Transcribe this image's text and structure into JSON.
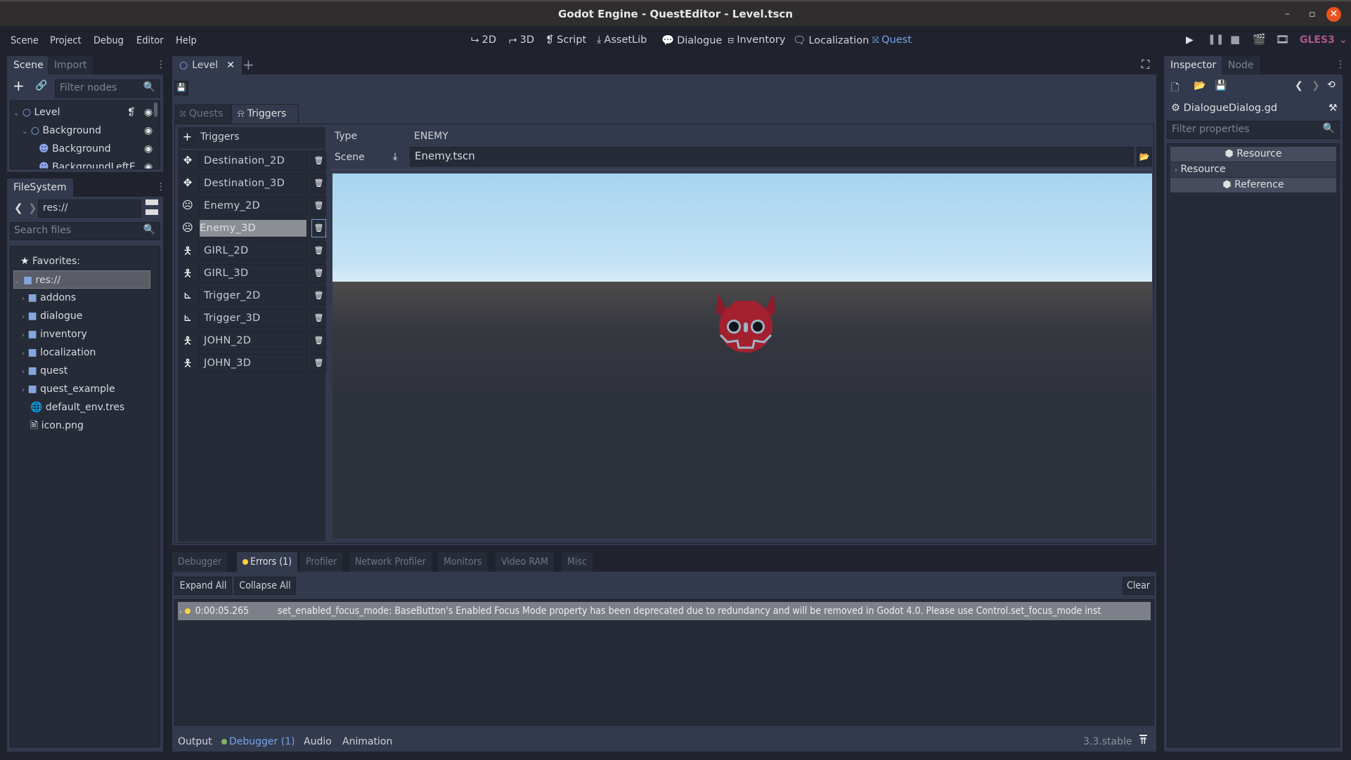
{
  "window": {
    "title": "Godot Engine - QuestEditor - Level.tscn",
    "controls": {
      "minimize": "–",
      "maximize": "▫",
      "close": "✕"
    }
  },
  "menu": [
    "Scene",
    "Project",
    "Debug",
    "Editor",
    "Help"
  ],
  "workspaces": [
    {
      "label": "2D",
      "icon": "2d-axis-icon"
    },
    {
      "label": "3D",
      "icon": "3d-axis-icon"
    },
    {
      "label": "Script",
      "icon": "script-icon"
    },
    {
      "label": "AssetLib",
      "icon": "download-icon"
    },
    {
      "label": "Dialogue",
      "icon": "dialogue-icon"
    },
    {
      "label": "Inventory",
      "icon": "inventory-icon"
    },
    {
      "label": "Localization",
      "icon": "localization-icon"
    },
    {
      "label": "Quest",
      "icon": "quest-icon",
      "active": true
    }
  ],
  "run_controls": {
    "renderer": "GLES3",
    "renderer_color": "#b0588a"
  },
  "scene_dock": {
    "tabs": [
      "Scene",
      "Import"
    ],
    "filter_placeholder": "Filter nodes",
    "nodes": [
      {
        "name": "Level",
        "depth": 0,
        "type": "node2d",
        "has_script": true
      },
      {
        "name": "Background",
        "depth": 1,
        "type": "node2d"
      },
      {
        "name": "Background",
        "depth": 2,
        "type": "sprite"
      },
      {
        "name": "BackgroundLeftE",
        "depth": 2,
        "type": "sprite"
      }
    ]
  },
  "filesystem": {
    "tab": "FileSystem",
    "path": "res://",
    "search_placeholder": "Search files",
    "favorites_label": "Favorites:",
    "root": "res://",
    "folders": [
      "addons",
      "dialogue",
      "inventory",
      "localization",
      "quest",
      "quest_example"
    ],
    "files": [
      {
        "name": "default_env.tres",
        "icon": "environment-icon"
      },
      {
        "name": "icon.png",
        "icon": "image-icon"
      }
    ]
  },
  "editor_tabs": {
    "active": "Level"
  },
  "quest_editor": {
    "tabs": [
      "Quests",
      "Triggers"
    ],
    "active_tab": "Triggers",
    "triggers_header": "Triggers",
    "triggers": [
      {
        "name": "Destination_2D",
        "icon": "move-icon"
      },
      {
        "name": "Destination_3D",
        "icon": "move-icon"
      },
      {
        "name": "Enemy_2D",
        "icon": "enemy-icon"
      },
      {
        "name": "Enemy_3D",
        "icon": "enemy-icon",
        "selected": true
      },
      {
        "name": "GIRL_2D",
        "icon": "person-icon"
      },
      {
        "name": "GIRL_3D",
        "icon": "person-icon"
      },
      {
        "name": "Trigger_2D",
        "icon": "lever-icon"
      },
      {
        "name": "Trigger_3D",
        "icon": "lever-icon"
      },
      {
        "name": "JOHN_2D",
        "icon": "person-icon"
      },
      {
        "name": "JOHN_3D",
        "icon": "person-icon"
      }
    ],
    "type_label": "Type",
    "type_value": "ENEMY",
    "scene_label": "Scene",
    "scene_value": "Enemy.tscn"
  },
  "debugger": {
    "tabs": [
      "Debugger",
      "Errors (1)",
      "Profiler",
      "Network Profiler",
      "Monitors",
      "Video RAM",
      "Misc"
    ],
    "active_tab": "Errors (1)",
    "expand_all": "Expand All",
    "collapse_all": "Collapse All",
    "clear": "Clear",
    "errors": [
      {
        "time": "0:00:05.265",
        "message": "set_enabled_focus_mode: BaseButton's Enabled Focus Mode property has been deprecated due to redundancy and will be removed in Godot 4.0. Please use Control.set_focus_mode inst"
      }
    ]
  },
  "bottom_bar": {
    "tabs": [
      "Output",
      "Debugger (1)",
      "Audio",
      "Animation"
    ],
    "active_tab": "Debugger (1)",
    "version": "3.3.stable"
  },
  "inspector": {
    "tabs": [
      "Inspector",
      "Node"
    ],
    "resource_name": "DialogueDialog.gd",
    "filter_placeholder": "Filter properties",
    "sections": [
      {
        "label": "Resource",
        "kind": "category"
      },
      {
        "label": "Resource",
        "kind": "group"
      },
      {
        "label": "Reference",
        "kind": "category"
      }
    ]
  },
  "colors": {
    "accent": "#76a6e8",
    "warning": "#ffd23f",
    "ok": "#7fb462",
    "bg": "#20232e",
    "panel": "#333a4d"
  }
}
